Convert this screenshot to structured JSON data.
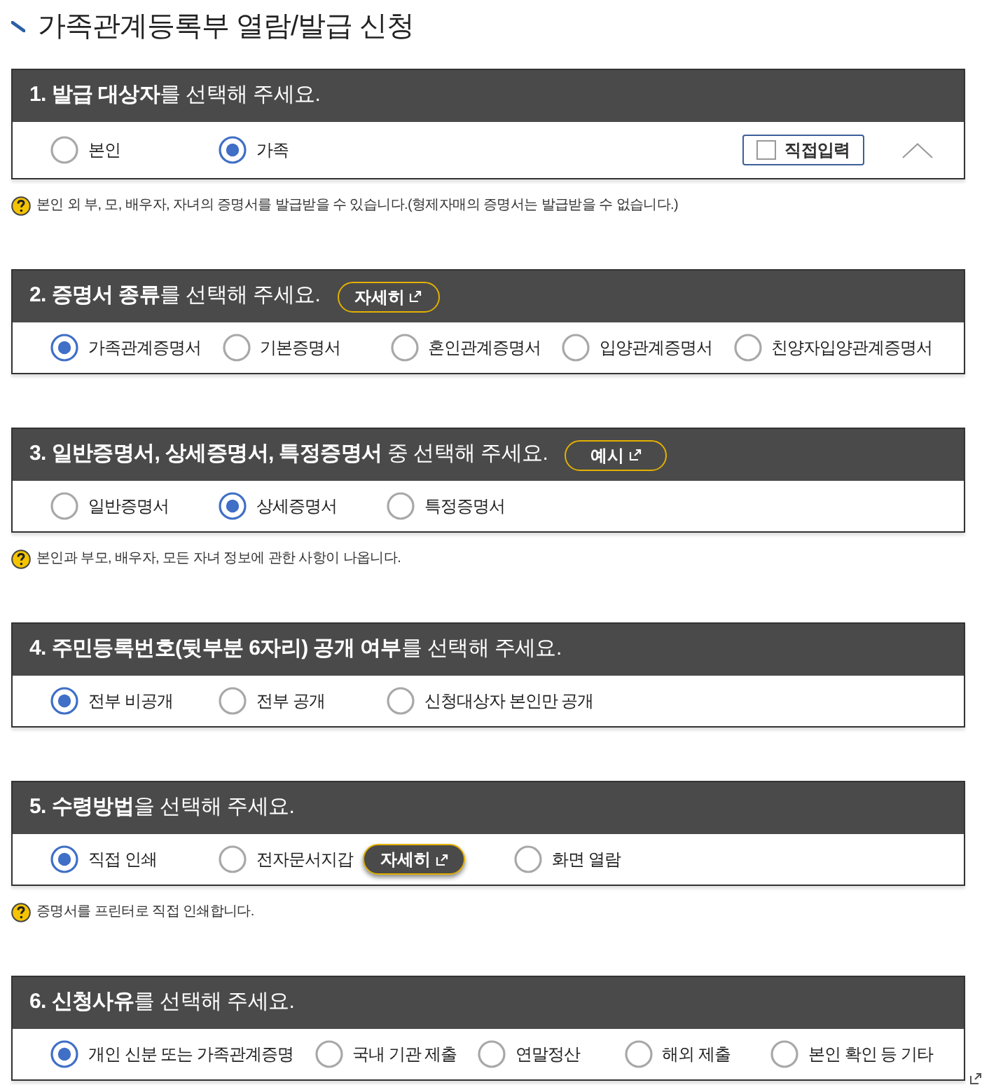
{
  "page_title": "가족관계등록부 열람/발급 신청",
  "sections": [
    {
      "heading": "**1. 발급 대상자**를 선택해 주세요.",
      "options": [
        {
          "label": "본인",
          "selected": false
        },
        {
          "label": "가족",
          "selected": true
        }
      ],
      "direct_input": {
        "label": "직접입력",
        "checked": false
      },
      "expanded": true,
      "note": "본인 외 부, 모, 배우자, 자녀의 증명서를 발급받을 수 있습니다.(형제자매의 증명서는 발급받을 수 없습니다.)"
    },
    {
      "heading": "**2. 증명서 종류**를 선택해 주세요.",
      "heading_button": "자세히",
      "options": [
        {
          "label": "가족관계증명서",
          "selected": true
        },
        {
          "label": "기본증명서",
          "selected": false
        },
        {
          "label": "혼인관계증명서",
          "selected": false
        },
        {
          "label": "입양관계증명서",
          "selected": false
        },
        {
          "label": "친양자입양관계증명서",
          "selected": false
        }
      ]
    },
    {
      "heading": "**3. 일반증명서, 상세증명서, 특정증명서** 중 선택해 주세요.",
      "heading_button": "예시",
      "options": [
        {
          "label": "일반증명서",
          "selected": false
        },
        {
          "label": "상세증명서",
          "selected": true
        },
        {
          "label": "특정증명서",
          "selected": false
        }
      ],
      "note": "본인과 부모, 배우자, 모든 자녀 정보에 관한 사항이 나옵니다."
    },
    {
      "heading": "**4. 주민등록번호(뒷부분 6자리) 공개 여부**를 선택해 주세요.",
      "options": [
        {
          "label": "전부 비공개",
          "selected": true
        },
        {
          "label": "전부 공개",
          "selected": false
        },
        {
          "label": "신청대상자 본인만 공개",
          "selected": false
        }
      ]
    },
    {
      "heading": "**5. 수령방법**을 선택해 주세요.",
      "options": [
        {
          "label": "직접 인쇄",
          "selected": true
        },
        {
          "label": "전자문서지갑",
          "selected": false,
          "button": "자세히"
        },
        {
          "label": "화면 열람",
          "selected": false
        }
      ],
      "note": "증명서를 프린터로 직접 인쇄합니다."
    },
    {
      "heading": "**6. 신청사유**를 선택해 주세요.",
      "options": [
        {
          "label": "개인 신분 또는 가족관계증명",
          "selected": true
        },
        {
          "label": "국내 기관 제출",
          "selected": false
        },
        {
          "label": "연말정산",
          "selected": false
        },
        {
          "label": "해외 제출",
          "selected": false
        },
        {
          "label": "본인 확인 등 기타",
          "selected": false
        }
      ]
    }
  ]
}
